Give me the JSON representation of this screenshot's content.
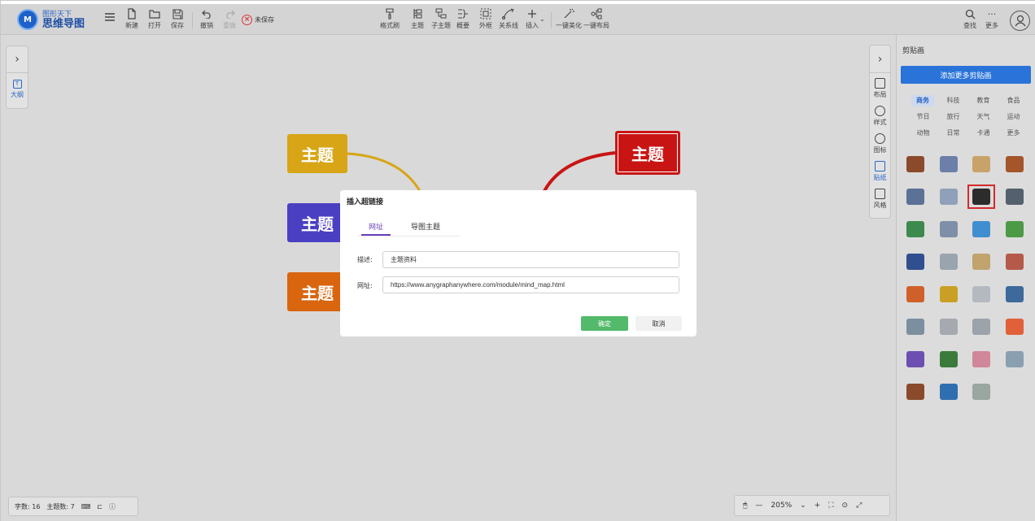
{
  "app": {
    "logo_mark": "M",
    "logo_sub": "图形天下",
    "logo_main": "思维导图"
  },
  "toolbar": {
    "new": "新建",
    "open": "打开",
    "save": "保存",
    "undo": "撤销",
    "redo": "重做",
    "unsaved": "未保存",
    "format_painter": "格式刷",
    "topic": "主题",
    "subtopic": "子主题",
    "summary": "概要",
    "boundary": "外框",
    "relation": "关系线",
    "insert": "插入",
    "beautify": "一键美化",
    "layout": "一键布局",
    "search": "查找",
    "more": "更多"
  },
  "canvas": {
    "outline": "大纲",
    "nodes": [
      "主题",
      "主题",
      "主题",
      "主题"
    ],
    "right_tools": [
      "布局",
      "样式",
      "图标",
      "贴纸",
      "风格"
    ]
  },
  "status": {
    "word_count": "字数: 16",
    "topic_count": "主题数: 7",
    "zoom": "205%"
  },
  "clipart": {
    "title": "剪贴画",
    "add_button": "添加更多剪贴画",
    "categories": [
      "商务",
      "科技",
      "教育",
      "食品",
      "节日",
      "旅行",
      "天气",
      "运动",
      "动物",
      "日常",
      "卡通",
      "更多"
    ],
    "items": [
      "briefcase-clock",
      "id-card",
      "credit-cards",
      "briefcase",
      "office-building",
      "business-card",
      "businessman",
      "calculator",
      "stock-chart",
      "employee-badge",
      "chat-bubbles",
      "money-stack",
      "decline-chart",
      "printer",
      "clipboard-pen",
      "handshake",
      "growth-chart",
      "keys",
      "envelope",
      "team",
      "monitor-id",
      "atm",
      "paperclip",
      "pie-chart",
      "network-gear",
      "line-chart",
      "eraser",
      "phone-qr",
      "stamp",
      "telephone",
      "document-check"
    ]
  },
  "dialog": {
    "title": "插入超链接",
    "tab_url": "网址",
    "tab_topic": "导图主题",
    "desc_label": "描述:",
    "desc_value": "主题资料",
    "url_label": "网址:",
    "url_value": "https://www.anygraphanywhere.com/module/mind_map.html",
    "ok": "确定",
    "cancel": "取消"
  }
}
